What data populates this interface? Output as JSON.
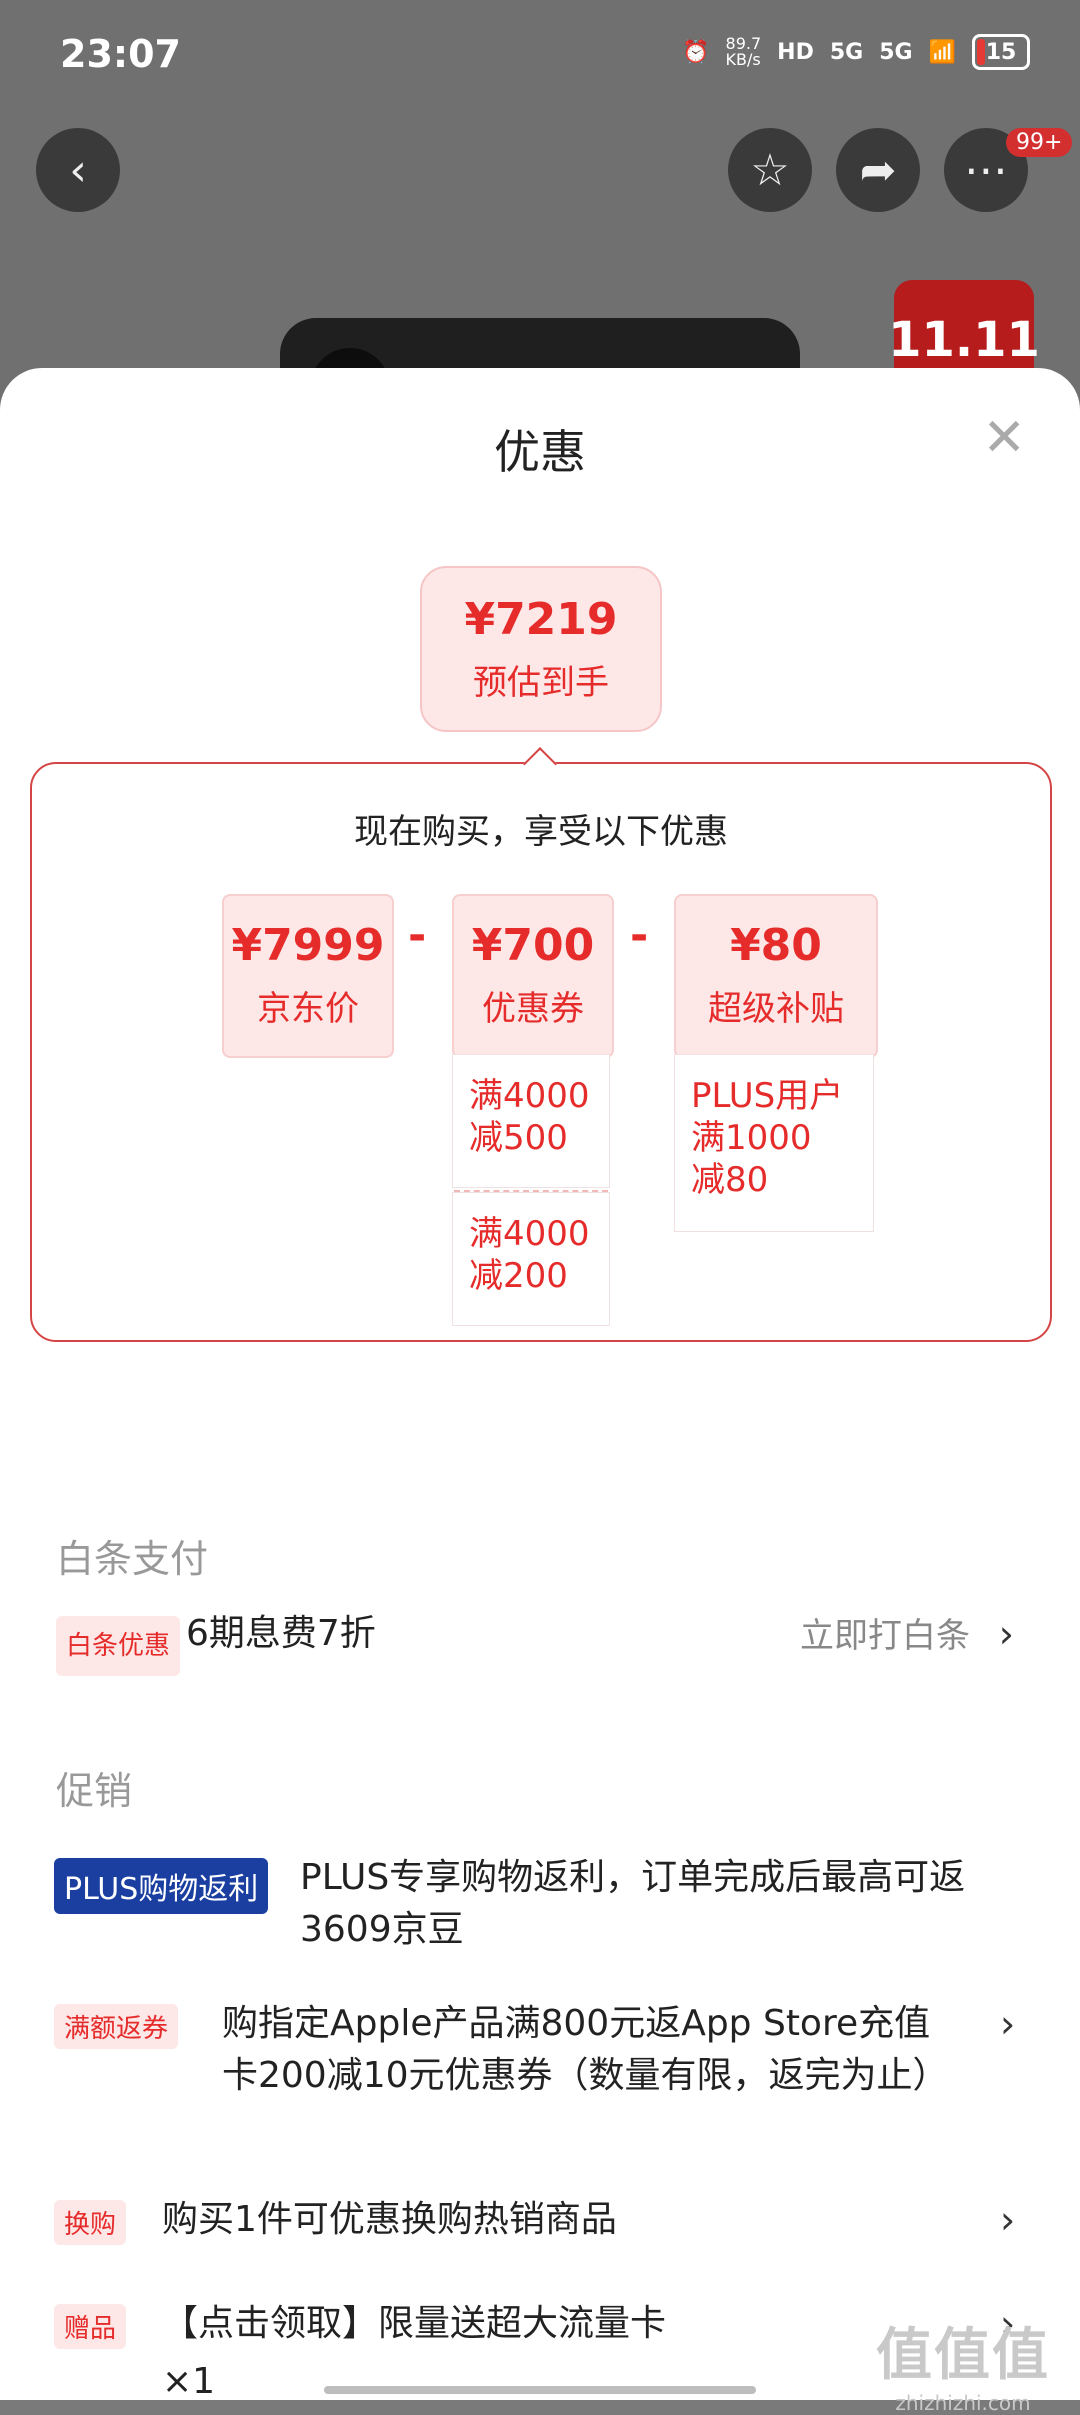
{
  "status_bar": {
    "time": "23:07",
    "net_speed": "89.7\nKB/s",
    "hd": "HD",
    "signal1": "5G",
    "signal2": "5G",
    "battery": "15"
  },
  "header": {
    "back_icon": "chevron-left-icon",
    "fav_icon": "star-icon",
    "share_icon": "share-icon",
    "more_icon": "more-icon",
    "badge": "99+",
    "brand": "11.11"
  },
  "sheet": {
    "title": "优惠",
    "close_icon": "close-icon",
    "estimate": {
      "price": "¥7219",
      "label": "预估到手"
    },
    "box_title": "现在购买，享受以下优惠",
    "items": [
      {
        "value": "¥7999",
        "label": "京东价"
      },
      {
        "value": "¥700",
        "label": "优惠券"
      },
      {
        "value": "¥80",
        "label": "超级补贴"
      }
    ],
    "minus": "-",
    "coupon_details": [
      "满4000\n减500",
      "满4000\n减200"
    ],
    "subsidy_detail": "PLUS用户\n满1000\n减80"
  },
  "baitiao": {
    "section_title": "白条支付",
    "tag": "白条优惠",
    "text": "6期息费7折",
    "action": "立即打白条",
    "chevron": "›"
  },
  "promo": {
    "section_title": "促销",
    "items": [
      {
        "tag": "PLUS购物返利",
        "text": "PLUS专享购物返利，订单完成后最高可返3609京豆"
      },
      {
        "tag": "满额返券",
        "text": "购指定Apple产品满800元返App Store充值卡200减10元优惠券（数量有限，返完为止）"
      },
      {
        "tag": "换购",
        "text": "购买1件可优惠换购热销商品"
      },
      {
        "tag": "赠品",
        "text": "【点击领取】限量送超大流量卡"
      }
    ],
    "gift_qty": "×1",
    "chevron": "›"
  },
  "watermark": {
    "big": "值值值",
    "small": "zhizhizhi.com"
  }
}
